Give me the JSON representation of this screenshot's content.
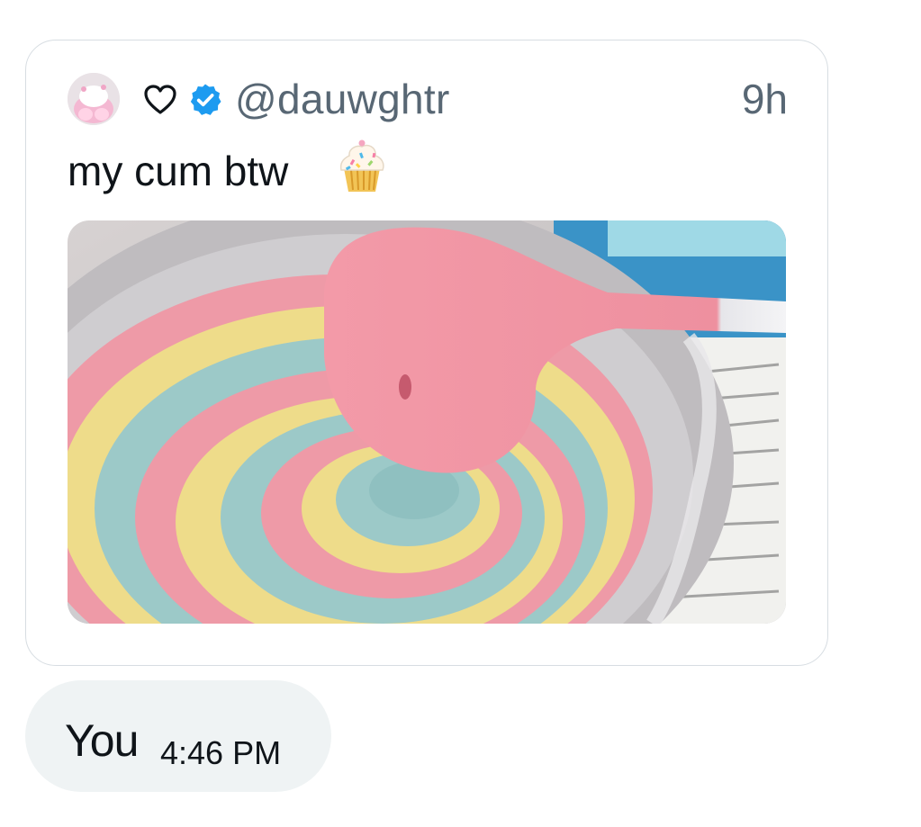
{
  "quote": {
    "handle": "@dauwghtr",
    "time": "9h",
    "text": "my cum btw",
    "icons": [
      "avatar",
      "heart-icon",
      "verified-icon",
      "cupcake-icon"
    ],
    "media": "photo-rainbow-swirl-batter-bowl"
  },
  "message": {
    "sender": "You",
    "time": "4:46 PM"
  },
  "colors": {
    "verified": "#1d9bf0",
    "secondary_text": "#586774",
    "bubble_bg": "#eff3f4",
    "border": "#d7dde2"
  }
}
